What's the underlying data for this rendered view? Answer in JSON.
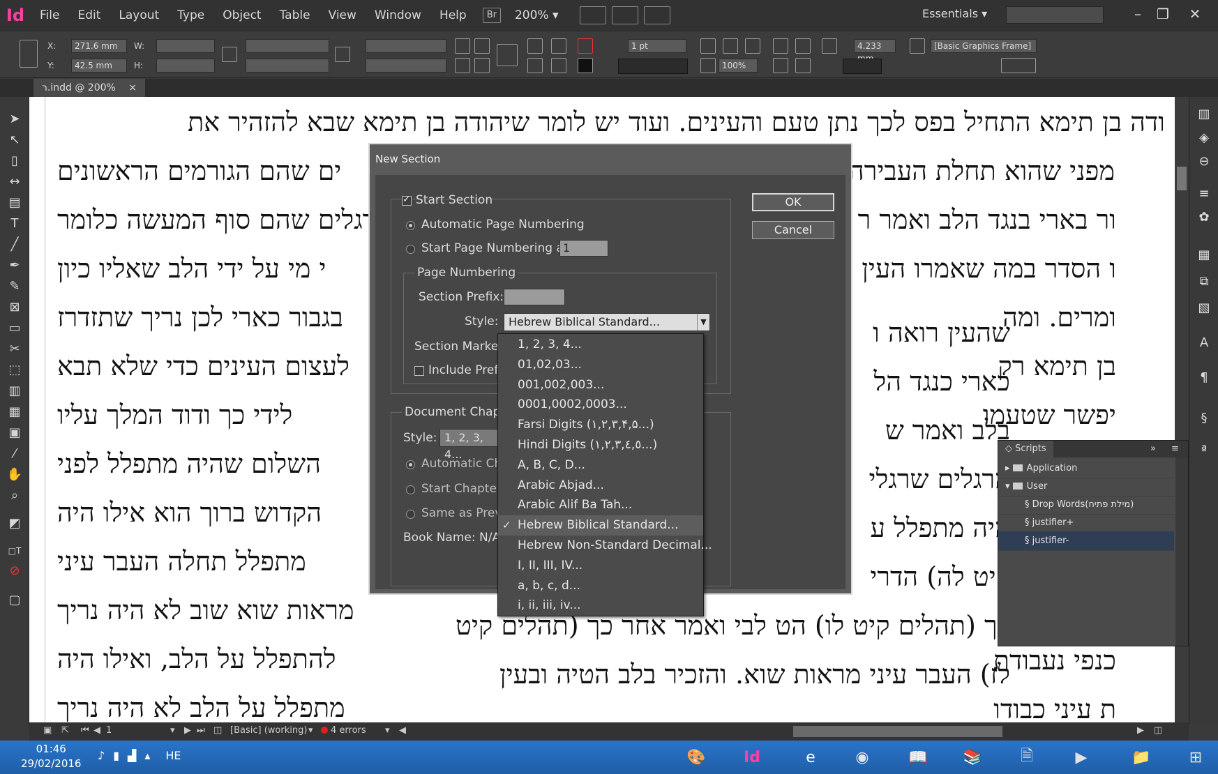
{
  "app": {
    "logo": "Id",
    "menus": [
      "File",
      "Edit",
      "Layout",
      "Type",
      "Object",
      "Table",
      "View",
      "Window",
      "Help"
    ],
    "bridge": "Br",
    "zoom": "200%",
    "workspace": "Essentials",
    "window_controls": [
      "–",
      "❐",
      "✕"
    ]
  },
  "control": {
    "x_label": "X:",
    "x_value": "271.6 mm",
    "y_label": "Y:",
    "y_value": "42.5 mm",
    "w_label": "W:",
    "h_label": "H:",
    "stroke_weight": "1 pt",
    "scale": "100%",
    "gap_value": "4.233 mm",
    "object_style": "[Basic Graphics Frame]"
  },
  "doc_tab": {
    "label": "ר.indd @ 200%",
    "close": "×"
  },
  "doc_lines_left": [
    "ודה בן תימא התחיל בפס לכך נתן טעם והעינים.  ועוד יש לומר שיהודה בן תימא שבא להזהיר את",
    "מפני שהוא תחלת העבירה ול",
    "ור בארי בנגד הלב ואמר ר",
    "ו הסדר במה שאמרו העין רואה",
    "ומרים.  ומה",
    "בן תימא רק",
    "יפשר שטעמו",
    "",
    "",
    "",
    "",
    "",
    "כנפי נעבודת",
    "ת עיני כבודו"
  ],
  "doc_lines_right": [
    "",
    "ים שהם הגורמים הראשונים",
    "רגלים שהם סוף המעשה כלומר",
    "י מי על ידי הלב שאליו כיון",
    "בגבור כארי לכן נריך שתזדרז",
    "לעצום העינים כדי שלא תבא",
    "לידי כך ודוד המלך עליו",
    "השלום שהיה מתפלל לפני",
    "הקדוש ברוך הוא אילו היה",
    "מתפלל תחלה העבר עיני",
    "מראות שוא שוב לא היה נריך",
    "להתפלל על הלב, ואילו היה",
    "מתפלל על הלב לא היה נריך",
    ""
  ],
  "doc_lines_middle": [
    "שהעין רואה ו",
    "כארי כנגד הל",
    "בלב ואמר ש",
    "הרגלים שרגלי",
    "היה מתפלל ע",
    "קיט לה) הדרי",
    "בך (תהלים קיט לו) הט לבי ואמר אחר כך (תהלים קיט",
    "לז) העבר עיני מראות שוא. והזכיר בלב הטיה ובעין"
  ],
  "dialog": {
    "title": "New Section",
    "start_section": "Start Section",
    "auto_numbering": "Automatic Page Numbering",
    "start_at_label": "Start Page Numbering at:",
    "start_at_value": "1",
    "page_numbering_group": "Page Numbering",
    "section_prefix": "Section Prefix:",
    "style_label": "Style:",
    "style_value": "Hebrew Biblical Standard...",
    "section_marker": "Section Marker:",
    "include_prefix": "Include Prefix",
    "chapter_group": "Document Chapter",
    "chapter_style_label": "Style:",
    "chapter_style_value": "1, 2, 3, 4...",
    "auto_chapter": "Automatic Chap",
    "start_chapter": "Start Chapter N",
    "same_as_prev": "Same as Previo",
    "book_name": "Book Name: N/A",
    "ok": "OK",
    "cancel": "Cancel"
  },
  "dropdown": {
    "items": [
      "1, 2, 3, 4...",
      "01,02,03...",
      "001,002,003...",
      "0001,0002,0003...",
      "Farsi Digits (۱,۲,۳,۴,۵...)",
      "Hindi Digits (١,٢,٣,٤,٥...)",
      "A, B, C, D...",
      "Arabic Abjad...",
      "Arabic Alif Ba Tah...",
      "Hebrew Biblical Standard...",
      "Hebrew Non-Standard Decimal...",
      "I, II, III, IV...",
      "a, b, c, d...",
      "i, ii, iii, iv..."
    ],
    "selected_index": 9
  },
  "scripts_panel": {
    "title": "Scripts",
    "rows": [
      {
        "label": "Application",
        "type": "folder"
      },
      {
        "label": "User",
        "type": "folder"
      },
      {
        "label": "Drop Words(מילת פתיח)",
        "type": "script"
      },
      {
        "label": "justifier+",
        "type": "script"
      },
      {
        "label": "justifier-",
        "type": "script"
      }
    ]
  },
  "statusbar": {
    "page": "1",
    "style": "[Basic] (working)",
    "errors": "4 errors"
  },
  "taskbar": {
    "time": "01:46",
    "date": "29/02/2016",
    "lang": "HE"
  },
  "colors": {
    "accent_logo": "#ff3fa4",
    "error_red": "#e02020",
    "taskbar_blue": "#2a74c9"
  }
}
